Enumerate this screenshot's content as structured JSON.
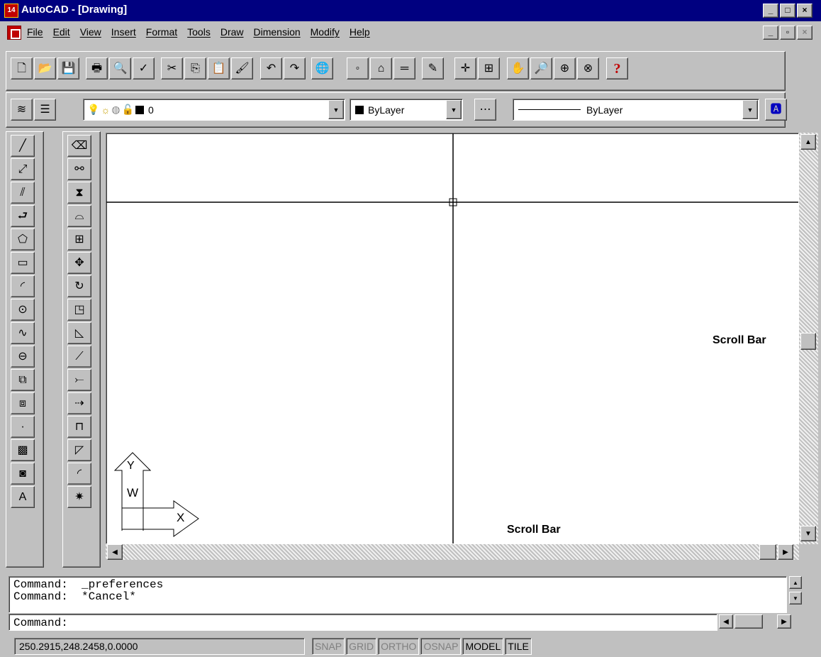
{
  "window": {
    "title": "AutoCAD - [Drawing]",
    "app_icon_text": "14",
    "controls": [
      "_",
      "□",
      "×"
    ]
  },
  "menubar": {
    "items": [
      "File",
      "Edit",
      "View",
      "Insert",
      "Format",
      "Tools",
      "Draw",
      "Dimension",
      "Modify",
      "Help"
    ],
    "doc_controls": [
      "_",
      "▫",
      "×"
    ]
  },
  "standard_toolbar": {
    "buttons": [
      "new-icon",
      "open-icon",
      "save-icon",
      "print-icon",
      "print-preview-icon",
      "spelling-icon",
      "cut-icon",
      "copy-icon",
      "paste-icon",
      "match-properties-icon",
      "undo-icon",
      "redo-icon",
      "launch-browser-icon",
      "snap-from-icon",
      "tracking-icon",
      "distance-icon",
      "redraw-icon",
      "ucs-icon",
      "named-views-icon",
      "pan-icon",
      "zoom-realtime-icon",
      "zoom-window-icon",
      "zoom-previous-icon",
      "help-icon"
    ],
    "help_label": "?"
  },
  "properties_toolbar": {
    "layer_value": "0",
    "color_value": "ByLayer",
    "linetype_value": "ByLayer"
  },
  "draw_toolbar": [
    "line-icon",
    "construction-line-icon",
    "multiline-icon",
    "polyline-icon",
    "polygon-icon",
    "rectangle-icon",
    "arc-icon",
    "circle-icon",
    "spline-icon",
    "ellipse-icon",
    "insert-block-icon",
    "make-block-icon",
    "point-icon",
    "hatch-icon",
    "region-icon",
    "multiline-text-icon"
  ],
  "modify_toolbar": [
    "erase-icon",
    "copy-object-icon",
    "mirror-icon",
    "offset-icon",
    "array-icon",
    "move-icon",
    "rotate-icon",
    "scale-icon",
    "stretch-icon",
    "lengthen-icon",
    "trim-icon",
    "extend-icon",
    "break-icon",
    "chamfer-icon",
    "fillet-icon",
    "explode-icon"
  ],
  "drawing": {
    "ucs_y_label": "Y",
    "ucs_w_label": "W",
    "ucs_x_label": "X",
    "vertical_scroll_label": "Scroll Bar",
    "horizontal_scroll_label": "Scroll Bar"
  },
  "command_window": {
    "history": [
      "Command:  _preferences",
      "Command:  *Cancel*"
    ],
    "prompt": "Command:"
  },
  "statusbar": {
    "coordinates": "250.2915,248.2458,0.0000",
    "modes": [
      {
        "label": "SNAP",
        "on": false
      },
      {
        "label": "GRID",
        "on": false
      },
      {
        "label": "ORTHO",
        "on": false
      },
      {
        "label": "OSNAP",
        "on": false
      },
      {
        "label": "MODEL",
        "on": true
      },
      {
        "label": "TILE",
        "on": true
      }
    ]
  }
}
